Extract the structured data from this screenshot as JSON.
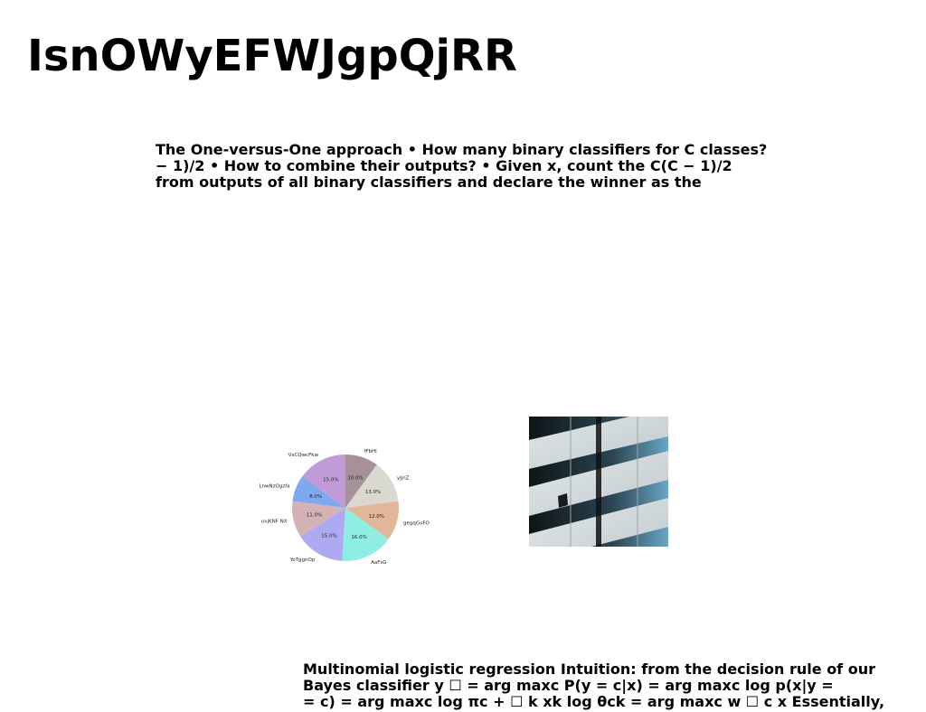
{
  "title": "IsnOWyEFWJgpQjRR",
  "paragraph1": [
    "The One-versus-One approach • How many binary classifiers for C classes?",
    "− 1)/2 • How to combine their outputs? • Given x, count the C(C − 1)/2",
    "from outputs of all binary classifiers and declare the winner as the"
  ],
  "paragraph2": [
    "Multinomial logistic regression Intuition: from the decision rule of our",
    "Bayes classifier y ☐ = arg maxc P(y = c|x) = arg maxc log p(x|y =",
    "= c) = arg maxc log πc + ☐ k xk log θck = arg maxc w ☐ c x Essentially,"
  ],
  "chart_data": {
    "type": "pie",
    "slices": [
      {
        "label": "fFbHl",
        "value": 10.0,
        "pct_label": "10.0%",
        "color": "#a6919a"
      },
      {
        "label": "yJjnZ",
        "value": 13.0,
        "pct_label": "13.0%",
        "color": "#d9d9cf"
      },
      {
        "label": "gegqGvFO",
        "value": 12.0,
        "pct_label": "12.0%",
        "color": "#e2b698"
      },
      {
        "label": "AaFsG",
        "value": 16.0,
        "pct_label": "16.0%",
        "color": "#8eeee4"
      },
      {
        "label": "YoTggnOp",
        "value": 15.0,
        "pct_label": "15.0%",
        "color": "#aeaaf2"
      },
      {
        "label": "uvjKNF NX",
        "value": 11.0,
        "pct_label": "11.0%",
        "color": "#d5b2b6"
      },
      {
        "label": "LnwNzOgzfa",
        "value": 8.0,
        "pct_label": "8.0%",
        "color": "#7fa8f1"
      },
      {
        "label": "VxCQwcFkw",
        "value": 15.0,
        "pct_label": "15.0%",
        "color": "#c19bd8"
      }
    ]
  }
}
